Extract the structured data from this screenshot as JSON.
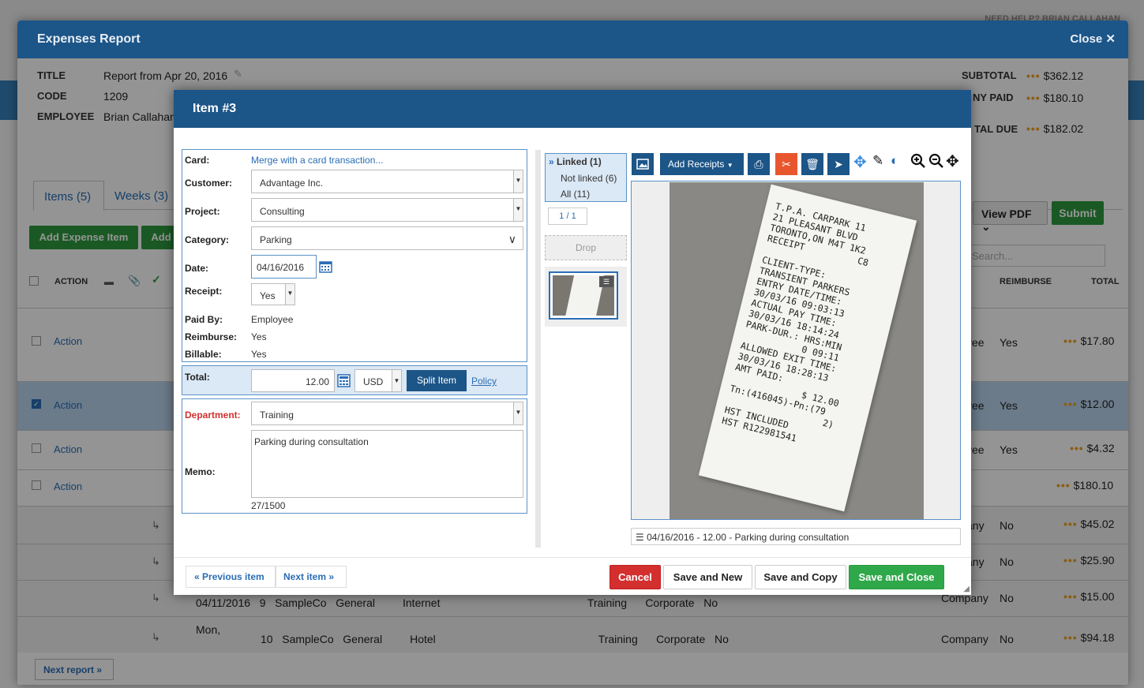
{
  "backdrop": {
    "top_right": "NEED HELP?   BRIAN CALLAHAN"
  },
  "report": {
    "window_title": "Expenses Report",
    "close_label": "Close",
    "title_label": "TITLE",
    "title_value": "Report from Apr 20, 2016",
    "code_label": "CODE",
    "code_value": "1209",
    "employee_label": "EMPLOYEE",
    "employee_value": "Brian Callahan",
    "subtotal_label": "SUBTOTAL",
    "subtotal_value": "$362.12",
    "paid_label": "NY PAID",
    "paid_value": "$180.10",
    "due_label": "TAL DUE",
    "due_value": "$182.02",
    "tab_items": "Items (5)",
    "tab_weeks": "Weeks (3)",
    "add_expense": "Add Expense Item",
    "add_more": "Add",
    "view_pdf": "View PDF",
    "submit": "Submit",
    "search_placeholder": "Search...",
    "col_action": "ACTION",
    "col_reimburse": "REIMBURSE",
    "col_total": "TOTAL",
    "rows": [
      {
        "action": "Action",
        "emp": "yee",
        "reimb": "Yes",
        "total": "$17.80"
      },
      {
        "action": "Action",
        "emp": "yee",
        "reimb": "Yes",
        "total": "$12.00"
      },
      {
        "action": "Action",
        "emp": "yee",
        "reimb": "Yes",
        "total": "$4.32"
      },
      {
        "action": "Action",
        "emp": "",
        "reimb": "",
        "total": "$180.10"
      },
      {
        "action": "",
        "emp": "any",
        "reimb": "No",
        "total": "$45.02"
      },
      {
        "action": "",
        "emp": "any",
        "reimb": "No",
        "total": "$25.90"
      },
      {
        "action": "",
        "emp": "Company",
        "reimb": "No",
        "total": "$15.00"
      },
      {
        "action": "",
        "emp": "Company",
        "reimb": "No",
        "total": "$94.18"
      }
    ],
    "bg_row7": "04/11/2016   9   SampleCo   General         Internet                                                Training      Corporate   No",
    "bg_row8a": "Mon,",
    "bg_row8b": "10   SampleCo   General         Hotel                                                     Training      Corporate   No",
    "next_report": "Next report"
  },
  "item": {
    "title": "Item #3",
    "card_label": "Card:",
    "card_link": "Merge with a card transaction...",
    "customer_label": "Customer:",
    "customer_value": "Advantage Inc.",
    "project_label": "Project:",
    "project_value": "Consulting",
    "category_label": "Category:",
    "category_value": "Parking",
    "date_label": "Date:",
    "date_value": "04/16/2016",
    "receipt_label": "Receipt:",
    "receipt_value": "Yes",
    "paidby_label": "Paid By:",
    "paidby_value": "Employee",
    "reimburse_label": "Reimburse:",
    "reimburse_value": "Yes",
    "billable_label": "Billable:",
    "billable_value": "Yes",
    "total_label": "Total:",
    "total_value": "12.00",
    "currency": "USD",
    "split_item": "Split Item",
    "policy": "Policy",
    "department_label": "Department:",
    "department_value": "Training",
    "memo_label": "Memo:",
    "memo_value": "Parking during consultation",
    "memo_count": "27/1500",
    "linked": "Linked (1)",
    "not_linked": "Not linked (6)",
    "all": "All (11)",
    "pager": "1 / 1",
    "drop": "Drop",
    "add_receipts": "Add Receipts",
    "caption": "04/16/2016 - 12.00 - Parking during consultation",
    "prev_item": "Previous item",
    "next_item": "Next item",
    "cancel": "Cancel",
    "save_new": "Save and New",
    "save_copy": "Save and Copy",
    "save_close": "Save and Close"
  },
  "receipt_text": [
    "T.P.A. CARPARK 11",
    "21 PLEASANT BLVD",
    "TORONTO,ON M4T 1K2",
    "RECEIPT          C8",
    "",
    "CLIENT-TYPE:",
    "TRANSIENT PARKERS",
    "ENTRY DATE/TIME:",
    "30/03/16 09:03:13",
    "ACTUAL PAY TIME:",
    "30/03/16 18:14:24",
    "PARK-DUR.: HRS:MIN",
    "           0 09:11",
    "ALLOWED EXIT TIME:",
    "30/03/16 18:28:13",
    "AMT PAID:",
    "             $ 12.00",
    "Tn:(416045)-Pn:(79",
    "                  2)",
    "HST INCLUDED",
    "HST R122981541"
  ],
  "colors": {
    "header": "#1c5588",
    "green": "#2d9a3e",
    "cancel": "#d32f2f",
    "accent": "#f0a020"
  }
}
